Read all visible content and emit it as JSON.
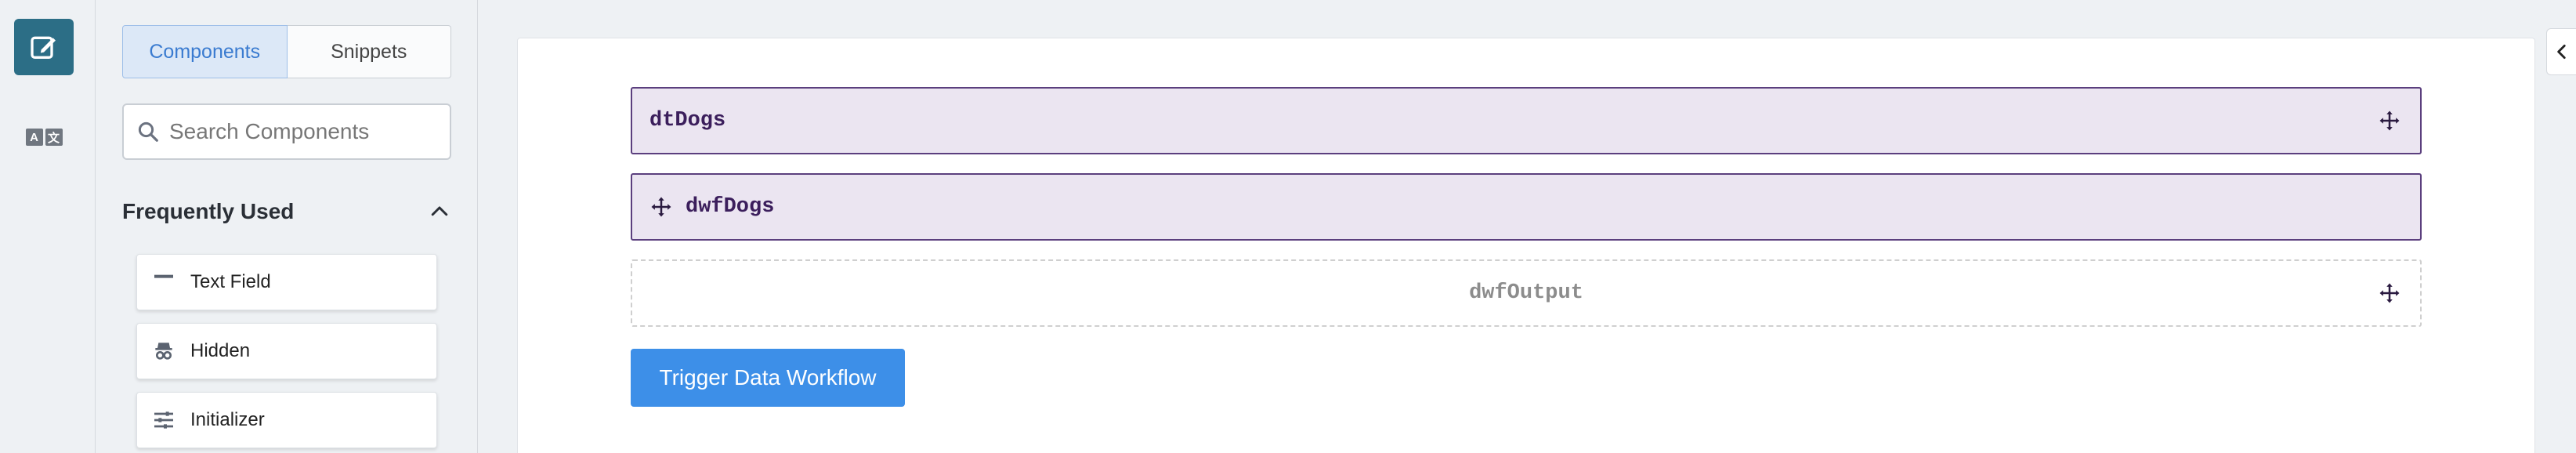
{
  "rail": {
    "edit_icon": "pencil-square-icon",
    "lang_icon": "translate-icon",
    "lang_left": "A",
    "lang_right": "文"
  },
  "panel": {
    "tabs": [
      {
        "label": "Components",
        "active": true
      },
      {
        "label": "Snippets",
        "active": false
      }
    ],
    "search": {
      "placeholder": "Search Components",
      "value": ""
    },
    "section": {
      "title": "Frequently Used",
      "expanded": true
    },
    "items": [
      {
        "label": "Text Field",
        "icon": "text-field-icon"
      },
      {
        "label": "Hidden",
        "icon": "hidden-icon"
      },
      {
        "label": "Initializer",
        "icon": "sliders-icon"
      }
    ]
  },
  "canvas": {
    "blocks": [
      {
        "name": "dtDogs"
      },
      {
        "name": "dwfDogs"
      },
      {
        "name": "dwfOutput"
      }
    ],
    "trigger_label": "Trigger Data Workflow"
  },
  "colors": {
    "accent": "#2c6e86",
    "primary_button": "#3d8fe8",
    "block_fill": "#ebe5f1",
    "block_border": "#5b3f7e",
    "tab_active": "#dce8f7"
  }
}
